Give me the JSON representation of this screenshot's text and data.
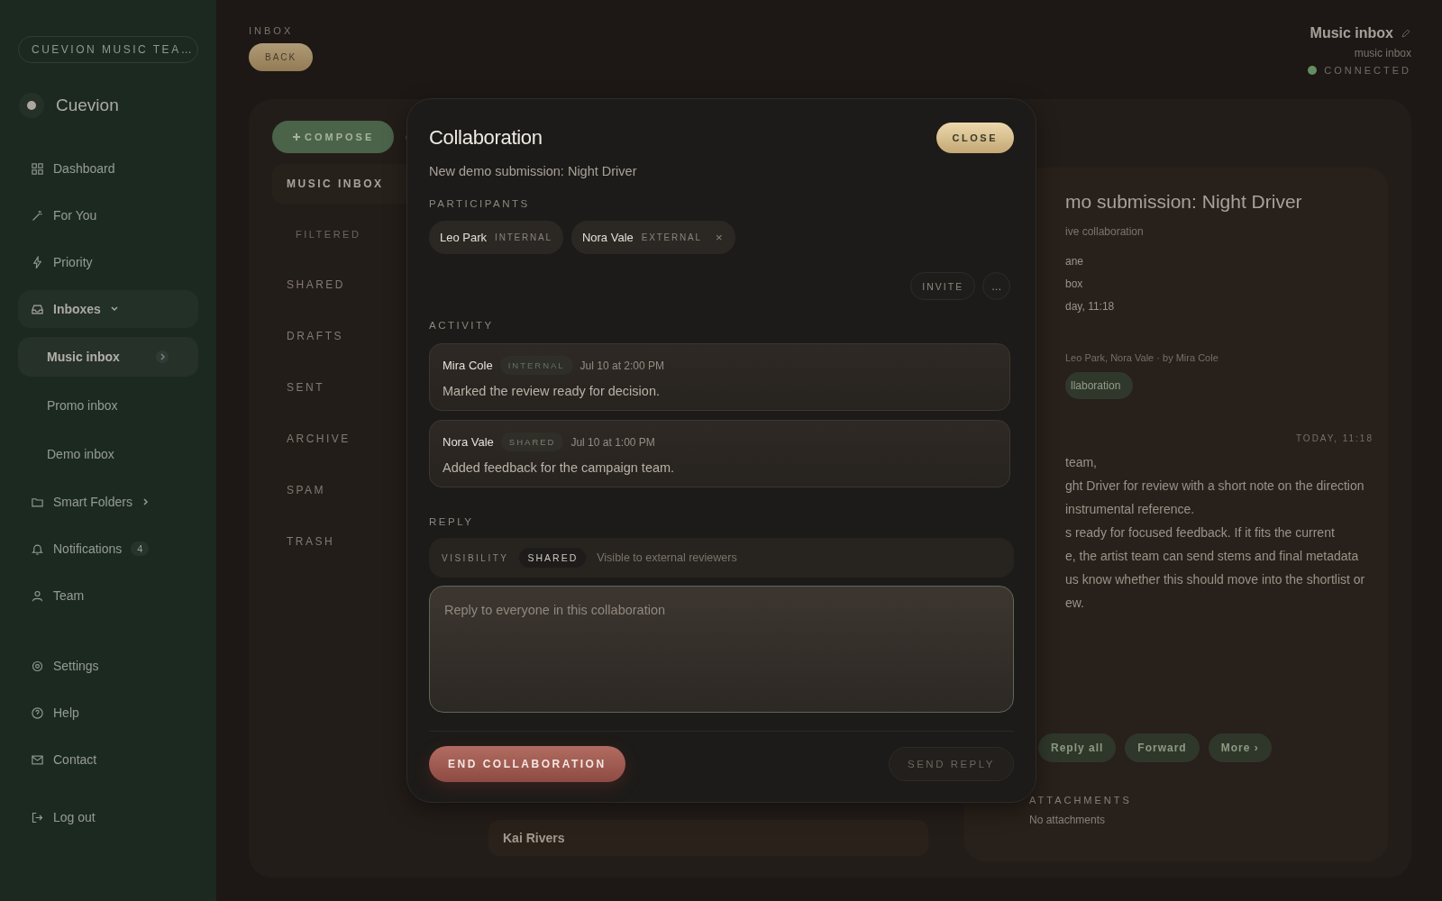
{
  "sidebar": {
    "workspace": "CUEVION MUSIC TEA…",
    "brand": "Cuevion",
    "items": [
      {
        "label": "Dashboard"
      },
      {
        "label": "For You"
      },
      {
        "label": "Priority"
      },
      {
        "label": "Inboxes",
        "expanded": true,
        "children": [
          {
            "label": "Music inbox",
            "selected": true
          },
          {
            "label": "Promo inbox",
            "selected": false
          },
          {
            "label": "Demo inbox",
            "selected": false
          }
        ]
      },
      {
        "label": "Smart Folders",
        "expanded": false
      },
      {
        "label": "Notifications",
        "badge": "4"
      },
      {
        "label": "Team"
      }
    ],
    "footer_items": [
      {
        "label": "Settings"
      },
      {
        "label": "Help"
      },
      {
        "label": "Contact"
      },
      {
        "label": "Log out"
      }
    ]
  },
  "header": {
    "eyebrow": "INBOX",
    "back": "BACK",
    "inbox_title": "Music inbox",
    "inbox_subtitle": "music inbox",
    "status": "CONNECTED",
    "connected": true
  },
  "toolbar": {
    "compose": "COMPOSE"
  },
  "folders": [
    {
      "label": "MUSIC INBOX",
      "selected": true,
      "sub": false
    },
    {
      "label": "FILTERED",
      "selected": false,
      "sub": true
    },
    {
      "label": "SHARED",
      "selected": false,
      "sub": false
    },
    {
      "label": "DRAFTS",
      "selected": false,
      "sub": false
    },
    {
      "label": "SENT",
      "selected": false,
      "sub": false
    },
    {
      "label": "ARCHIVE",
      "selected": false,
      "sub": false
    },
    {
      "label": "SPAM",
      "selected": false,
      "sub": false
    },
    {
      "label": "TRASH",
      "selected": false,
      "sub": false
    }
  ],
  "message_list": [
    {
      "sender": "Kai Rivers"
    }
  ],
  "reading_pane": {
    "title": "mo submission: Night Driver",
    "subtitle": "ive collaboration",
    "meta": [
      "ane",
      "box",
      "day, 11:18"
    ],
    "participants_line": "Leo Park, Nora Vale · by Mira Cole",
    "chip": "llaboration",
    "timestamp": "TODAY, 11:18",
    "body": [
      "team,",
      "ght Driver for review with a short note on the direction",
      "instrumental reference.",
      "s ready for focused feedback. If it fits the current",
      "e, the artist team can send stems and final metadata",
      "us know whether this should move into the shortlist or",
      "ew."
    ],
    "actions": [
      "Reply all",
      "Forward",
      "More ›"
    ],
    "attachments_label": "ATTACHMENTS",
    "attachments_empty": "No attachments"
  },
  "modal": {
    "title": "Collaboration",
    "close": "CLOSE",
    "subject": "New demo submission: Night Driver",
    "participants_label": "PARTICIPANTS",
    "participants": [
      {
        "name": "Leo Park",
        "role": "INTERNAL",
        "removable": false
      },
      {
        "name": "Nora Vale",
        "role": "EXTERNAL",
        "removable": true
      }
    ],
    "remove_glyph": "×",
    "invite": "INVITE",
    "more": "...",
    "activity_label": "ACTIVITY",
    "activity": [
      {
        "author": "Mira Cole",
        "tag": "INTERNAL",
        "color": "#5d7560",
        "time": "Jul 10 at 2:00 PM",
        "text": "Marked the review ready for decision."
      },
      {
        "author": "Nora Vale",
        "tag": "SHARED",
        "color": "#857b70",
        "time": "Jul 10 at 1:00 PM",
        "text": "Added feedback for the campaign team."
      }
    ],
    "reply_label": "REPLY",
    "visibility_label": "VISIBILITY",
    "visibility": "SHARED",
    "visibility_hint": "Visible to external reviewers",
    "reply_placeholder": "Reply to everyone in this collaboration",
    "end": "END COLLABORATION",
    "send": "SEND REPLY",
    "send_disabled": true
  }
}
